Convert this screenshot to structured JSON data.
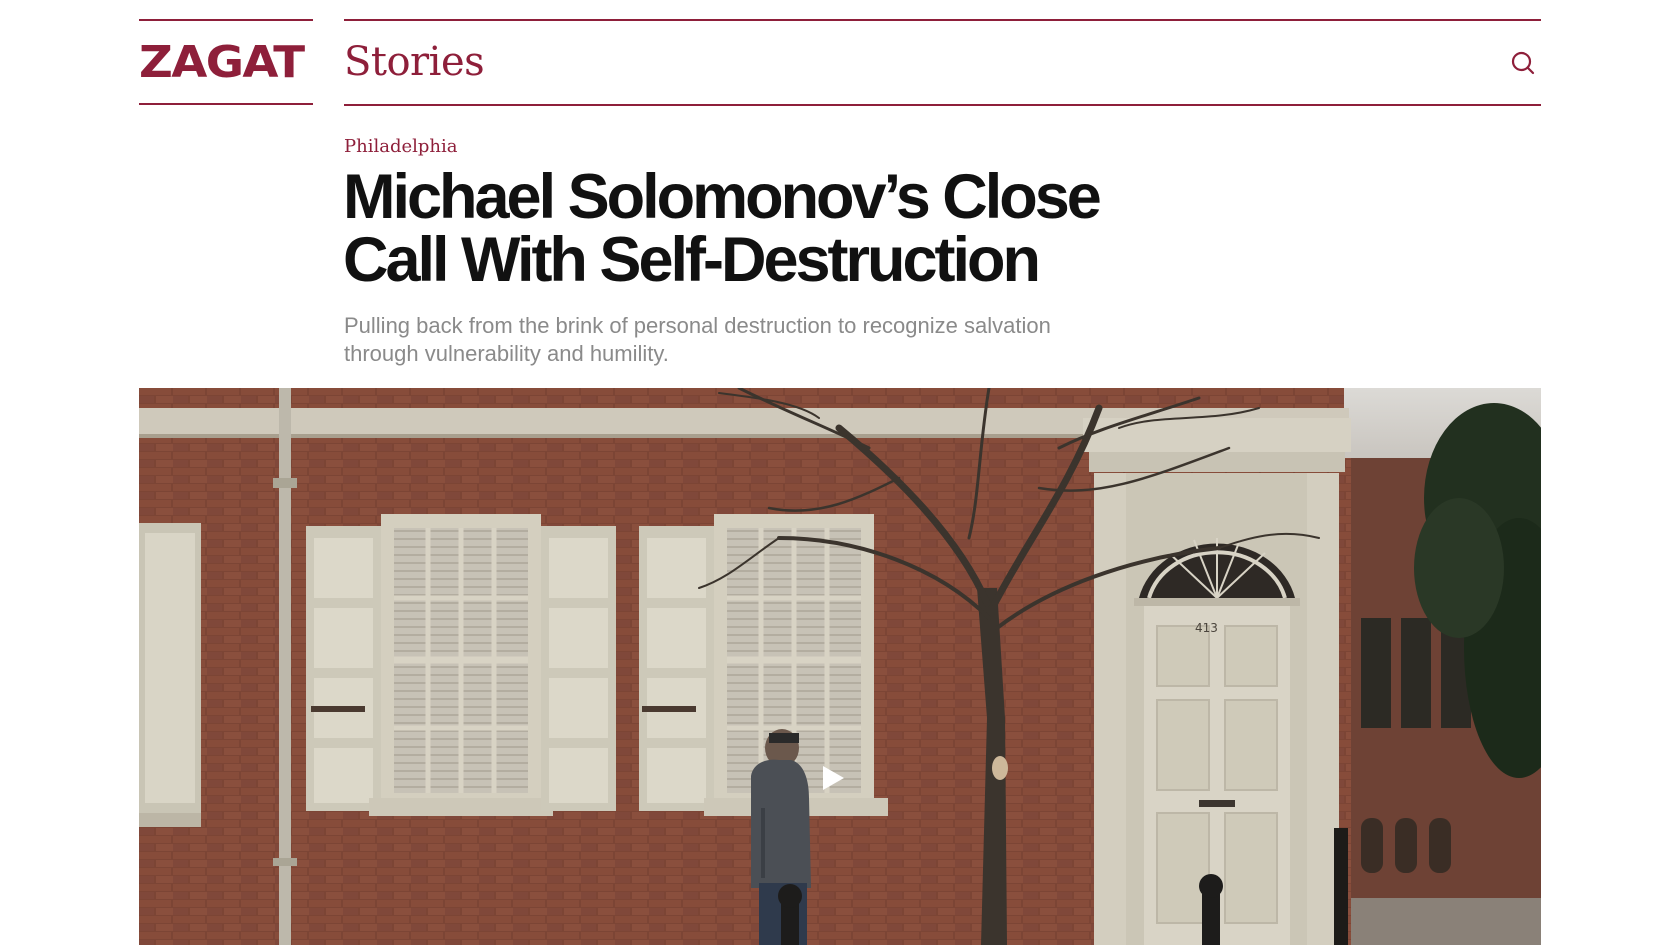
{
  "brand": {
    "logo_text": "ZAGAT",
    "section_title": "Stories",
    "brand_color": "#8e1f3a"
  },
  "header": {
    "search_icon": "search-icon"
  },
  "article": {
    "kicker": "Philadelphia",
    "headline": "Michael Solomonov’s Close Call With Self-Destruction",
    "dek": "Pulling back from the brink of personal destruction to recognize salvation through vulnerability and humility."
  },
  "hero": {
    "door_number": "413",
    "play_icon": "play-icon"
  }
}
